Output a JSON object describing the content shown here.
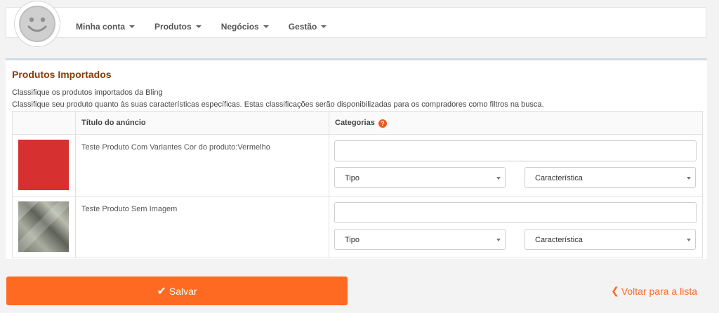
{
  "nav": {
    "items": [
      {
        "label": "Minha conta"
      },
      {
        "label": "Produtos"
      },
      {
        "label": "Negócios"
      },
      {
        "label": "Gestão"
      }
    ]
  },
  "panel": {
    "title": "Produtos Importados",
    "description_1": "Classifique os produtos importados da Bling",
    "description_2": "Classifique seu produto quanto às suas características específicas. Estas classificações serão disponibilizadas para os compradores como filtros na busca.",
    "columns": {
      "image": "",
      "title": "Título do anúncio",
      "categories": "Categorias",
      "categories_help": "?"
    },
    "rows": [
      {
        "title": "Teste Produto Com Variantes Cor do produto:Vermelho",
        "thumbnail_color": "#d63030",
        "category_value": "",
        "type_select": "Tipo",
        "feature_select": "Característica"
      },
      {
        "title": "Teste Produto Sem Imagem",
        "thumbnail_color": "#8a8d82",
        "category_value": "",
        "type_select": "Tipo",
        "feature_select": "Característica"
      }
    ]
  },
  "actions": {
    "save_label": "Salvar",
    "back_label": "Voltar para a lista"
  },
  "colors": {
    "accent": "#ff6a22",
    "title": "#8b3a0a"
  }
}
